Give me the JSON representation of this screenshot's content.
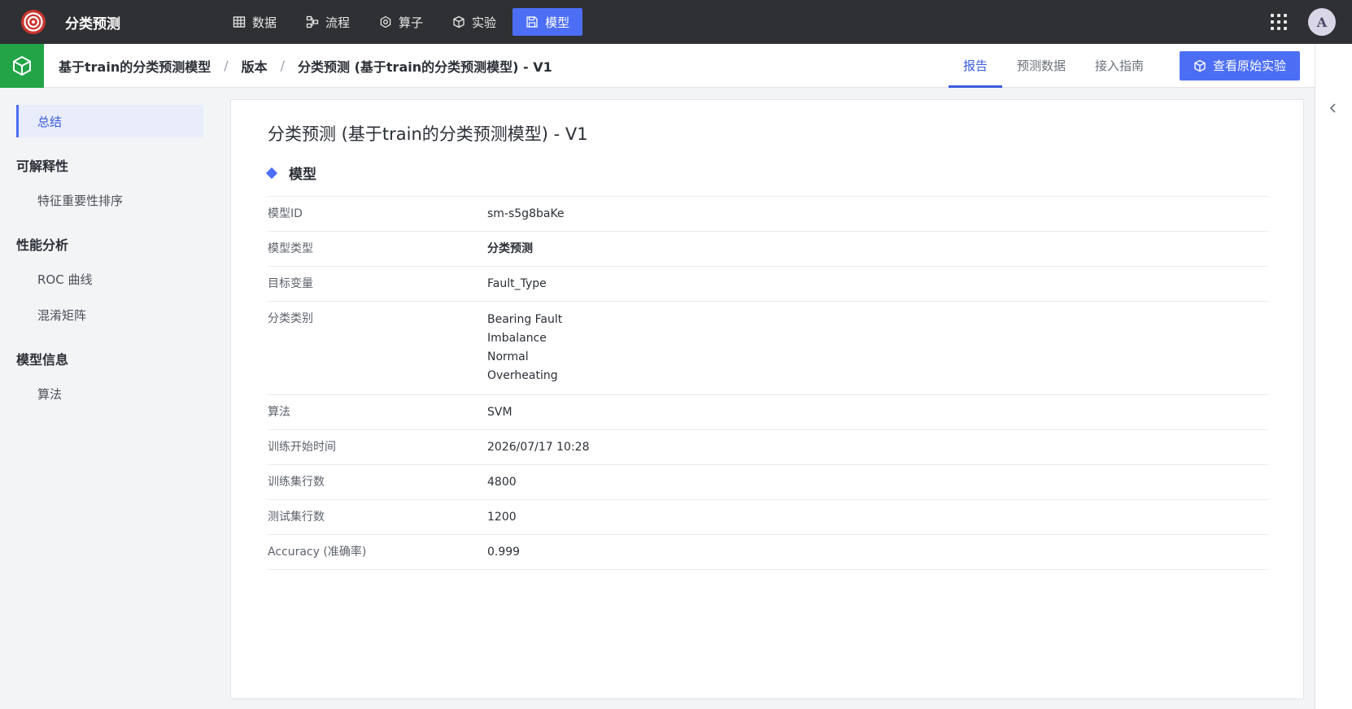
{
  "app": {
    "title": "分类预测",
    "avatar_letter": "A"
  },
  "nav": [
    {
      "label": "数据",
      "icon": "table-icon"
    },
    {
      "label": "流程",
      "icon": "workflow-icon"
    },
    {
      "label": "算子",
      "icon": "operator-icon"
    },
    {
      "label": "实验",
      "icon": "cube-icon"
    },
    {
      "label": "模型",
      "icon": "save-icon",
      "active": true
    }
  ],
  "breadcrumb": {
    "model": "基于train的分类预测模型",
    "sep": "/",
    "versions": "版本",
    "current": "分类预测 (基于train的分类预测模型) - V1"
  },
  "tabs": [
    {
      "label": "报告",
      "active": true
    },
    {
      "label": "预测数据"
    },
    {
      "label": "接入指南"
    }
  ],
  "view_experiment_button": "查看原始实验",
  "sidebar": {
    "summary": "总结",
    "groups": [
      {
        "title": "可解释性",
        "items": [
          "特征重要性排序"
        ]
      },
      {
        "title": "性能分析",
        "items": [
          "ROC 曲线",
          "混淆矩阵"
        ]
      },
      {
        "title": "模型信息",
        "items": [
          "算法"
        ]
      }
    ]
  },
  "main": {
    "title": "分类预测 (基于train的分类预测模型) - V1",
    "section": "模型",
    "rows": [
      {
        "label": "模型ID",
        "value": "sm-s5g8baKe"
      },
      {
        "label": "模型类型",
        "value": "分类预测",
        "bold": true
      },
      {
        "label": "目标变量",
        "value": "Fault_Type"
      },
      {
        "label": "分类类别",
        "values": [
          "Bearing Fault",
          "Imbalance",
          "Normal",
          "Overheating"
        ]
      },
      {
        "label": "算法",
        "value": "SVM"
      },
      {
        "label": "训练开始时间",
        "value": "2026/07/17 10:28"
      },
      {
        "label": "训练集行数",
        "value": "4800"
      },
      {
        "label": "测试集行数",
        "value": "1200"
      },
      {
        "label": "Accuracy (准确率)",
        "value": "0.999"
      }
    ]
  },
  "colors": {
    "accent": "#4c6ef5",
    "topbar": "#2f3033",
    "model_badge": "#22a447"
  }
}
